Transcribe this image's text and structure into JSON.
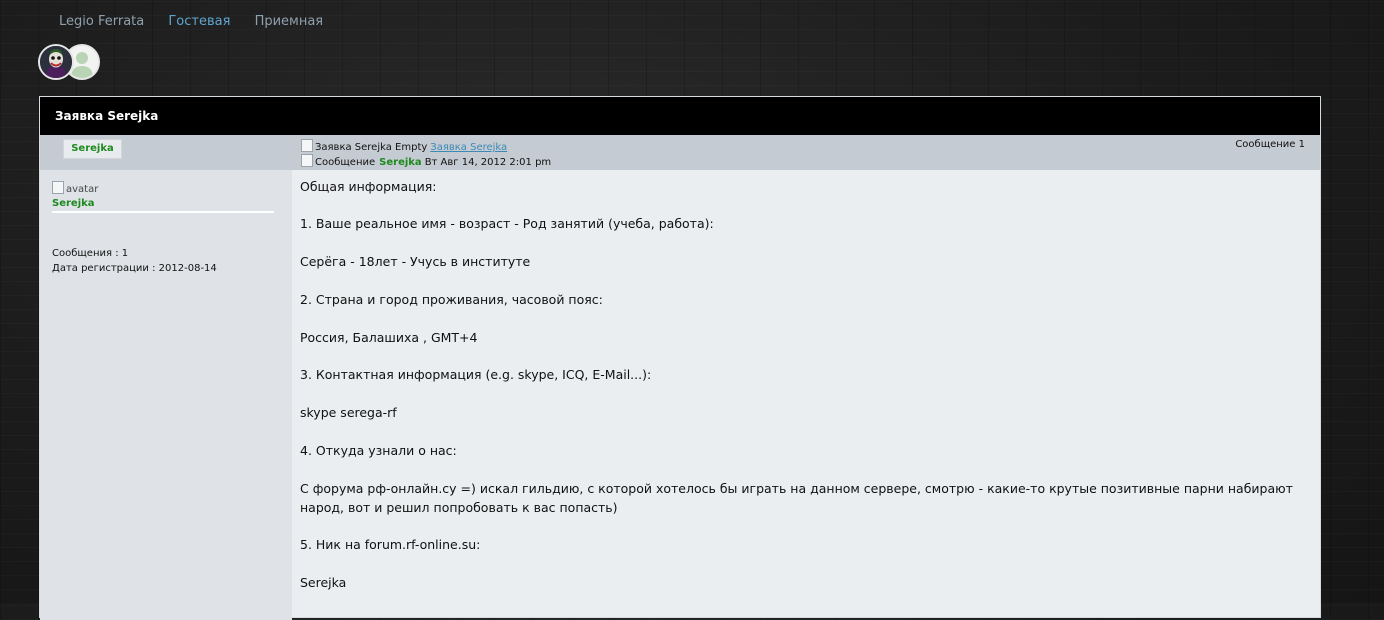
{
  "nav": {
    "site": "Legio Ferrata",
    "guest": "Гостевая",
    "reception": "Приемная"
  },
  "topic": {
    "title": "Заявка Serejka"
  },
  "post": {
    "author_box": "Serejka",
    "icon_alt": "Заявка Serejka Empty",
    "title_link": "Заявка Serejka",
    "msg_alt": "Сообщение",
    "nick": "Serejka",
    "date": "Вт Авг 14, 2012 2:01 pm",
    "number": "Сообщение 1"
  },
  "profile": {
    "avatar_alt": "avatar",
    "nick": "Serejka",
    "posts": "Сообщения : 1",
    "registered": "Дата регистрации : 2012-08-14"
  },
  "content": {
    "lines": [
      "Общая информация:",
      "1. Ваше реальное имя - возраст - Род занятий (учеба, работа):",
      "Серёга - 18лет - Учусь в институте",
      "2. Страна и город проживания, часовой пояс:",
      "Россия, Балашиха , GMT+4",
      "3. Контактная информация (e.g. skype, ICQ, E-Mail...):",
      "skype serega-rf",
      "4. Откуда узнали о нас:",
      "С форума рф-онлайн.су =) искал гильдию, с которой хотелось бы играть на данном сервере, смотрю - какие-то крутые позитивные парни набирают народ, вот и решил попробовать к вас попасть)",
      "5. Ник на forum.rf-online.su:",
      "Serejka"
    ]
  },
  "colors": {
    "titlebar": "#000000",
    "nick_green": "#1e8a1e",
    "link_blue": "#3d89b4",
    "nav_active": "#5fa6cf"
  }
}
